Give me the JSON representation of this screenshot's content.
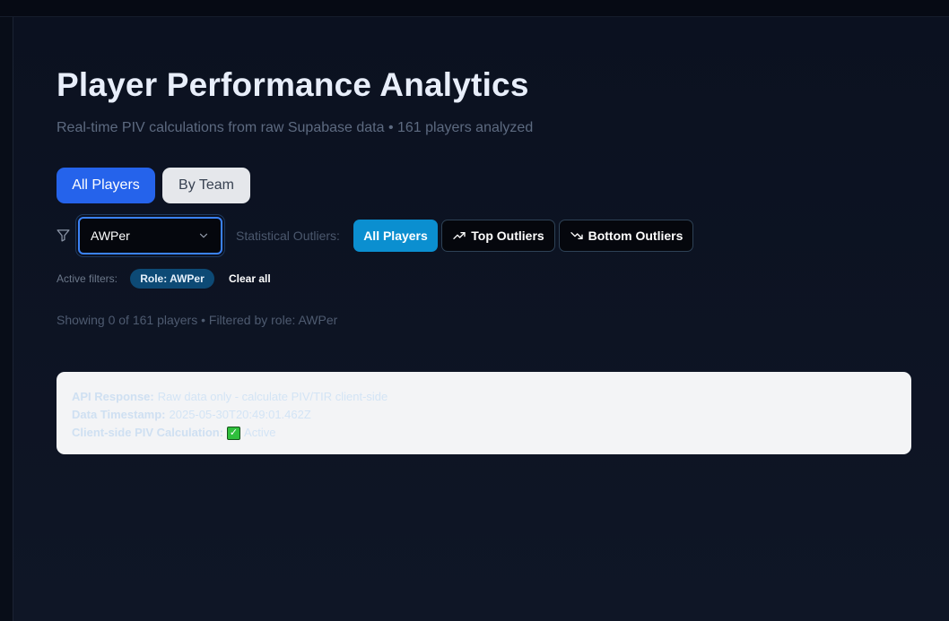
{
  "page": {
    "title": "Player Performance Analytics",
    "subtitle": "Real-time PIV calculations from raw Supabase data • 161 players analyzed"
  },
  "view_tabs": [
    {
      "label": "All Players",
      "active": true
    },
    {
      "label": "By Team",
      "active": false
    }
  ],
  "filters": {
    "filter_icon": "filter-icon",
    "role_select": {
      "value": "AWPer",
      "icon": "chevron-down-icon"
    },
    "outliers_label": "Statistical Outliers:",
    "outlier_buttons": [
      {
        "label": "All Players",
        "active": true
      },
      {
        "label": "Top Outliers",
        "icon": "trending-up-icon",
        "active": false
      },
      {
        "label": "Bottom Outliers",
        "icon": "trending-down-icon",
        "active": false
      }
    ],
    "active_filters_label": "Active filters:",
    "active_chips": [
      {
        "label": "Role: AWPer"
      }
    ],
    "clear_all_label": "Clear all"
  },
  "results": {
    "showing_text": "Showing 0 of 161 players • Filtered by role: AWPer"
  },
  "info_card": {
    "lines": [
      {
        "key": "API Response:",
        "value": "Raw data only - calculate PIV/TIR client-side"
      },
      {
        "key": "Data Timestamp:",
        "value": "2025-05-30T20:49:01.462Z"
      },
      {
        "key": "Client-side PIV Calculation:",
        "icon": "check-mark-emoji",
        "value": "Active"
      }
    ]
  },
  "colors": {
    "background": "#0b1120",
    "primary_blue": "#2563eb",
    "outlier_active": "#0b8fd0",
    "chip_bg": "#0d4a75"
  }
}
